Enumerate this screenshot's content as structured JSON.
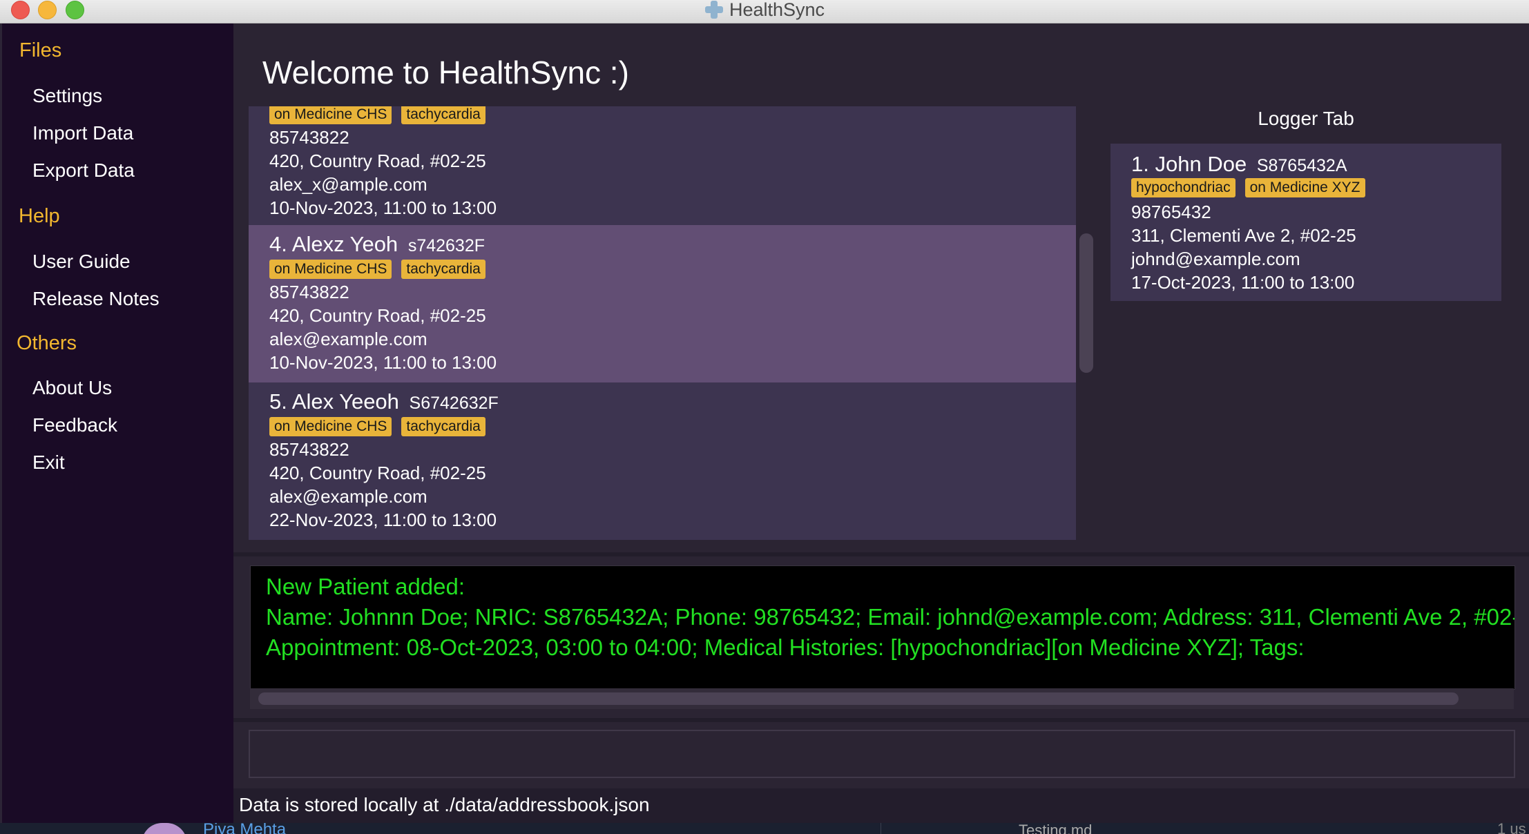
{
  "window": {
    "title": "HealthSync"
  },
  "sidebar": {
    "sections": [
      {
        "heading": "Files",
        "items": [
          "Settings",
          "Import Data",
          "Export Data"
        ]
      },
      {
        "heading": "Help",
        "items": [
          "User Guide",
          "Release Notes"
        ]
      },
      {
        "heading": "Others",
        "items": [
          "About Us",
          "Feedback",
          "Exit"
        ]
      }
    ]
  },
  "main": {
    "welcome": "Welcome to HealthSync :)"
  },
  "patients": [
    {
      "tags": [
        "on Medicine CHS",
        "tachycardia"
      ],
      "phone": "85743822",
      "address": "420, Country Road, #02-25",
      "email": "alex_x@ample.com",
      "appointment": "10-Nov-2023, 11:00 to 13:00"
    },
    {
      "index": "4.",
      "name": "Alexz Yeoh",
      "nric": "s742632F",
      "tags": [
        "on Medicine CHS",
        "tachycardia"
      ],
      "phone": "85743822",
      "address": "420, Country Road, #02-25",
      "email": "alex@example.com",
      "appointment": "10-Nov-2023, 11:00 to 13:00"
    },
    {
      "index": "5.",
      "name": "Alex Yeeoh",
      "nric": "S6742632F",
      "tags": [
        "on Medicine CHS",
        "tachycardia"
      ],
      "phone": "85743822",
      "address": "420, Country Road, #02-25",
      "email": "alex@example.com",
      "appointment": "22-Nov-2023, 11:00 to 13:00"
    }
  ],
  "logger": {
    "title": "Logger Tab",
    "entry": {
      "index": "1.",
      "name": "John Doe",
      "nric": "S8765432A",
      "tags": [
        "hypochondriac",
        "on Medicine XYZ"
      ],
      "phone": "98765432",
      "address": "311, Clementi Ave 2, #02-25",
      "email": "johnd@example.com",
      "appointment": "17-Oct-2023, 11:00 to 13:00"
    }
  },
  "result": {
    "lines": [
      "New Patient added:",
      "Name: Johnnn Doe; NRIC: S8765432A; Phone: 98765432; Email: johnd@example.com; Address: 311, Clementi Ave 2, #02-",
      "Appointment: 08-Oct-2023, 03:00 to 04:00; Medical Histories: [hypochondriac][on Medicine XYZ]; Tags:"
    ]
  },
  "command": {
    "value": ""
  },
  "status": {
    "text": "Data is stored locally at ./data/addressbook.json"
  },
  "background": {
    "taskbar_name": "Piya Mehta",
    "taskbar_file": "Testing.md",
    "taskbar_right": "1 us"
  },
  "colors": {
    "accent": "#f2b72f",
    "tag": "#e9b43a",
    "result_text": "#22e022",
    "selected_card": "#624e74"
  }
}
